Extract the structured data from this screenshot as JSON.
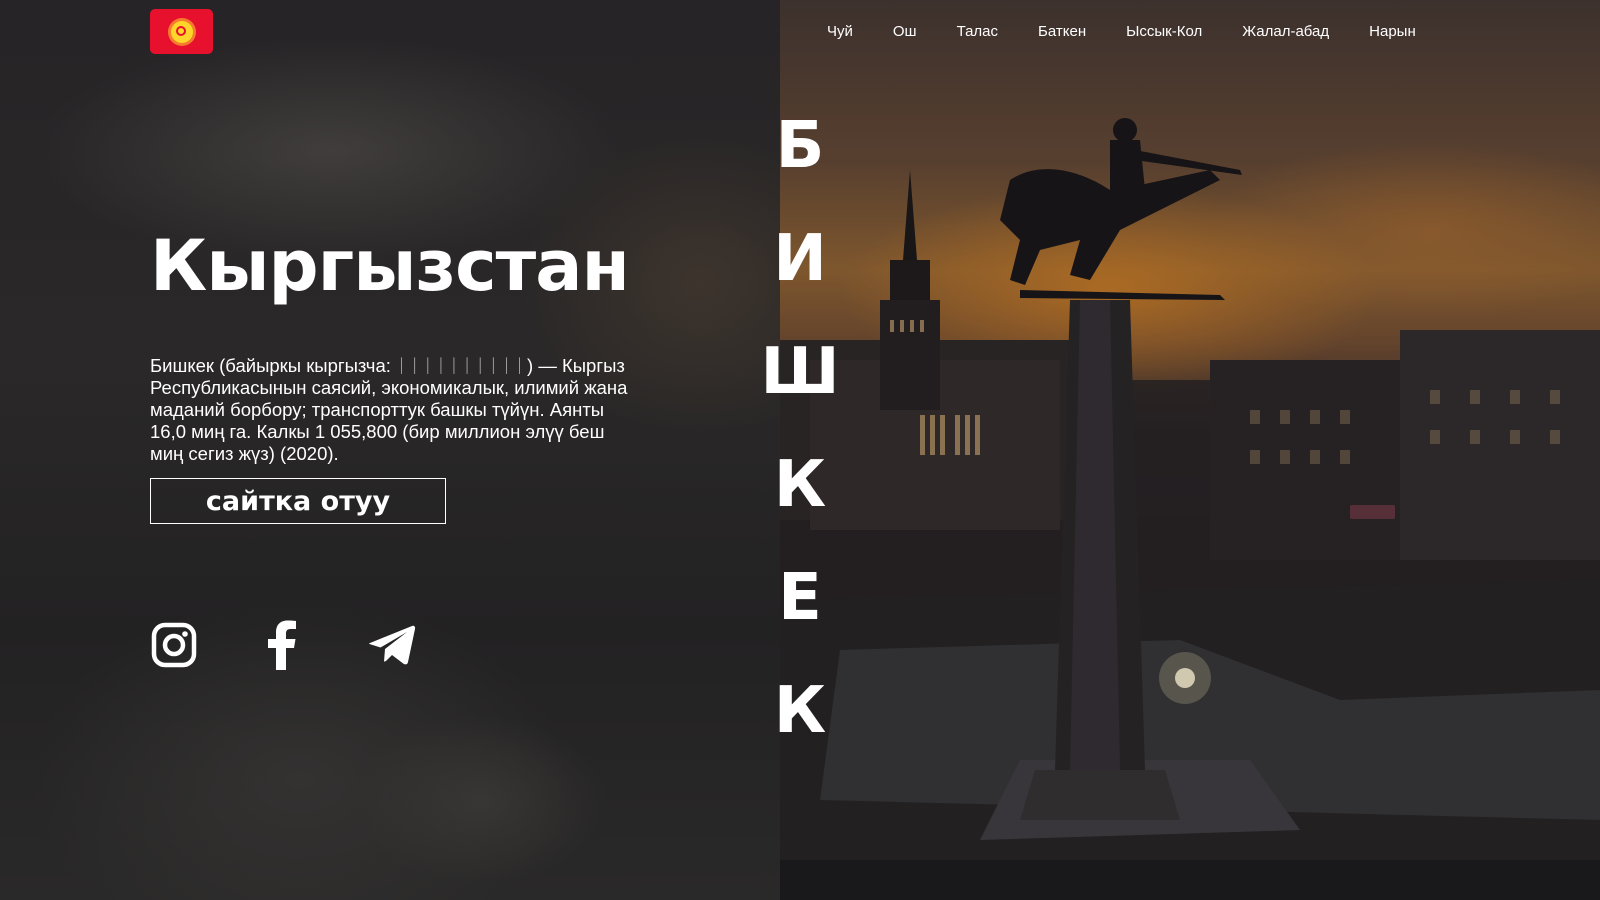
{
  "header": {
    "logo_icon": "kyrgyzstan-flag-icon",
    "flag_colors": {
      "field": "#e8112d",
      "sun": "#ffd52b"
    },
    "nav_items": [
      {
        "label": "Чуй"
      },
      {
        "label": "Ош"
      },
      {
        "label": "Талас"
      },
      {
        "label": "Баткен"
      },
      {
        "label": "Ысcык-Кол"
      },
      {
        "label": "Жалал-абад"
      },
      {
        "label": "Нарын"
      }
    ]
  },
  "hero": {
    "title": "Кыргызстан",
    "description_before": "Бишкек (байыркы кыргызча: ",
    "description_glyphs": "ᛁᛁᛁᛁᛁᛁᛁᛁᛁᛁ",
    "description_after": ") — Кыргыз Республикасынын саясий, экономикалык, илимий жана маданий борбору; транспорттук башкы түйүн. Аянты 16,0 миң га. Калкы 1 055,800 (бир миллион элүү беш миң сегиз жүз) (2020).",
    "cta_label": "сайтка отуу"
  },
  "socials": [
    {
      "icon": "instagram-icon"
    },
    {
      "icon": "facebook-icon"
    },
    {
      "icon": "telegram-icon"
    }
  ],
  "vertical_title": {
    "letters": [
      "Б",
      "И",
      "Ш",
      "К",
      "Е",
      "К"
    ]
  },
  "background_photo": {
    "subject": "bishkek-manas-monument-sunset-photo"
  }
}
